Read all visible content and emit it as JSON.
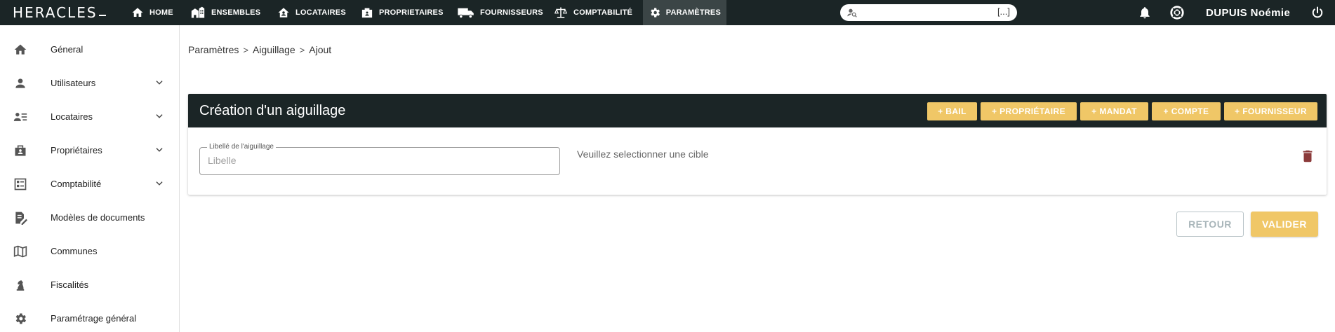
{
  "app": {
    "logo_text": "HERACLES"
  },
  "nav": {
    "home": "HOME",
    "ensembles": "ENSEMBLES",
    "locataires": "LOCATAIRES",
    "proprietaires": "PROPRIETAIRES",
    "fournisseurs": "FOURNISSEURS",
    "comptabilite": "COMPTABILITÉ",
    "parametres": "PARAMÈTRES"
  },
  "search": {
    "placeholder": "",
    "value": "",
    "ellipsis": "[...]"
  },
  "user": {
    "name": "DUPUIS Noémie"
  },
  "sidebar": {
    "items": [
      {
        "label": "Géneral"
      },
      {
        "label": "Utilisateurs"
      },
      {
        "label": "Locataires"
      },
      {
        "label": "Propriétaires"
      },
      {
        "label": "Comptabilité"
      },
      {
        "label": "Modèles de documents"
      },
      {
        "label": "Communes"
      },
      {
        "label": "Fiscalités"
      },
      {
        "label": "Paramétrage général"
      }
    ]
  },
  "breadcrumb": {
    "items": [
      "Paramètres",
      "Aiguillage",
      "Ajout"
    ],
    "separator": ">"
  },
  "card": {
    "title": "Création d'un aiguillage",
    "add_buttons": [
      "+ BAIL",
      "+ PROPRIÉTAIRE",
      "+ MANDAT",
      "+ COMPTE",
      "+ FOURNISSEUR"
    ],
    "field_label": "Libellé de l'aiguillage",
    "field_placeholder": "Libelle",
    "field_value": "",
    "target_message": "Veuillez selectionner une cible"
  },
  "actions": {
    "retour": "RETOUR",
    "valider": "VALIDER"
  },
  "colors": {
    "topbar": "#1b2526",
    "accent": "#f0c767",
    "trash": "#8b3a3a"
  }
}
